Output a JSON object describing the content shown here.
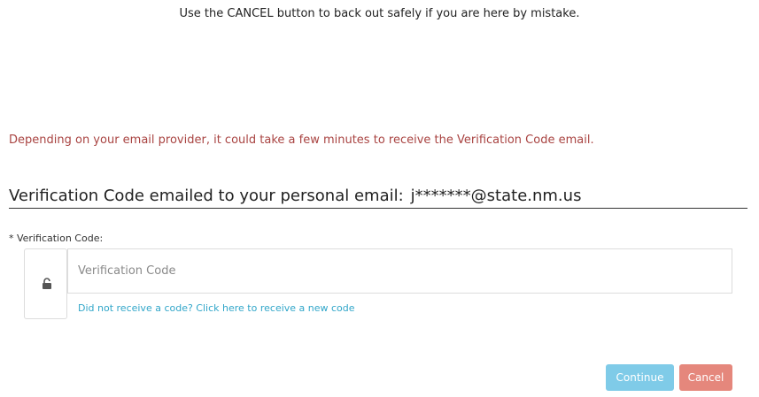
{
  "notice": "Use the CANCEL button to back out safely if you are here by mistake.",
  "delay_warning": "Depending on your email provider, it could take a few minutes to receive the Verification Code email.",
  "heading": {
    "text": "Verification Code emailed to your personal email:",
    "email": "j*******@state.nm.us"
  },
  "form": {
    "label": "* Verification Code:",
    "input_value": "",
    "input_placeholder": "Verification Code",
    "resend_link": "Did not receive a code? Click here to receive a new code",
    "lock_icon": "unlocked-padlock-icon"
  },
  "buttons": {
    "continue_label": "Continue",
    "cancel_label": "Cancel"
  },
  "colors": {
    "warning_text": "#a94442",
    "link": "#31a6c9",
    "continue_bg": "#7fcbe8",
    "cancel_bg": "#e5877c"
  }
}
